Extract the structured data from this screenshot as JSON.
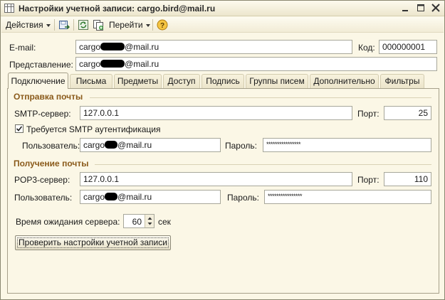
{
  "window": {
    "title": "Настройки учетной записи: cargo.bird@mail.ru",
    "controls": [
      "minimize",
      "maximize",
      "close"
    ]
  },
  "toolbar": {
    "actions_label": "Действия",
    "goto_label": "Перейти",
    "icons": [
      "save-close-icon",
      "refresh-icon",
      "copy-icon",
      "help-icon"
    ]
  },
  "account": {
    "email_label": "E-mail:",
    "email_prefix": "cargo",
    "email_suffix": "@mail.ru",
    "code_label": "Код:",
    "code_value": "000000001",
    "representation_label": "Представление:",
    "representation_prefix": "cargo",
    "representation_suffix": "@mail.ru"
  },
  "tabs": [
    {
      "label": "Подключение",
      "active": true
    },
    {
      "label": "Письма",
      "active": false
    },
    {
      "label": "Предметы",
      "active": false
    },
    {
      "label": "Доступ",
      "active": false
    },
    {
      "label": "Подпись",
      "active": false
    },
    {
      "label": "Группы писем",
      "active": false
    },
    {
      "label": "Дополнительно",
      "active": false
    },
    {
      "label": "Фильтры",
      "active": false
    }
  ],
  "outgoing": {
    "section_title": "Отправка почты",
    "server_label": "SMTP-сервер:",
    "server_value": "127.0.0.1",
    "port_label": "Порт:",
    "port_value": "25",
    "auth_checkbox_label": "Требуется SMTP аутентификация",
    "auth_checked": true,
    "user_label": "Пользователь:",
    "user_prefix": "cargo",
    "user_suffix": "@mail.ru",
    "password_label": "Пароль:",
    "password_value": "****************"
  },
  "incoming": {
    "section_title": "Получение почты",
    "server_label": "POP3-сервер:",
    "server_value": "127.0.0.1",
    "port_label": "Порт:",
    "port_value": "110",
    "user_label": "Пользователь:",
    "user_prefix": "cargo",
    "user_suffix": "@mail.ru",
    "password_label": "Пароль:",
    "password_value": "****************"
  },
  "timeout": {
    "label": "Время ожидания сервера:",
    "value": "60",
    "unit": "сек"
  },
  "check_button_label": "Проверить настройки учетной записи",
  "colors": {
    "background": "#fbf7e6",
    "section_title": "#8a5a1a",
    "field_border": "#a7a79a"
  }
}
